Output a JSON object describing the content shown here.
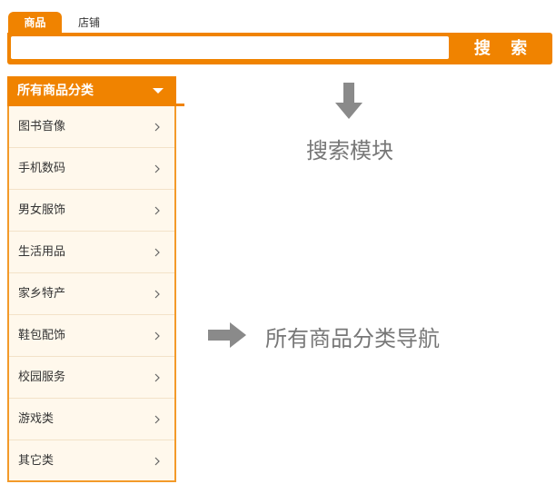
{
  "search_module": {
    "tabs": [
      {
        "label": "商品",
        "active": true
      },
      {
        "label": "店铺",
        "active": false
      }
    ],
    "input_value": "",
    "button_label": "搜 索"
  },
  "category_nav": {
    "header_label": "所有商品分类",
    "items": [
      {
        "label": "图书音像"
      },
      {
        "label": "手机数码"
      },
      {
        "label": "男女服饰"
      },
      {
        "label": "生活用品"
      },
      {
        "label": "家乡特产"
      },
      {
        "label": "鞋包配饰"
      },
      {
        "label": "校园服务"
      },
      {
        "label": "游戏类"
      },
      {
        "label": "其它类"
      }
    ]
  },
  "annotations": {
    "search_label": "搜索模块",
    "nav_label": "所有商品分类导航"
  },
  "colors": {
    "accent": "#f08300",
    "category_bg": "#fff8ec",
    "annotation_gray": "#777777"
  },
  "icons": {
    "dropdown": "triangle-down-icon",
    "item_chevron": "chevron-right-icon",
    "annotation_down": "arrow-down-icon",
    "annotation_right": "arrow-right-icon"
  }
}
